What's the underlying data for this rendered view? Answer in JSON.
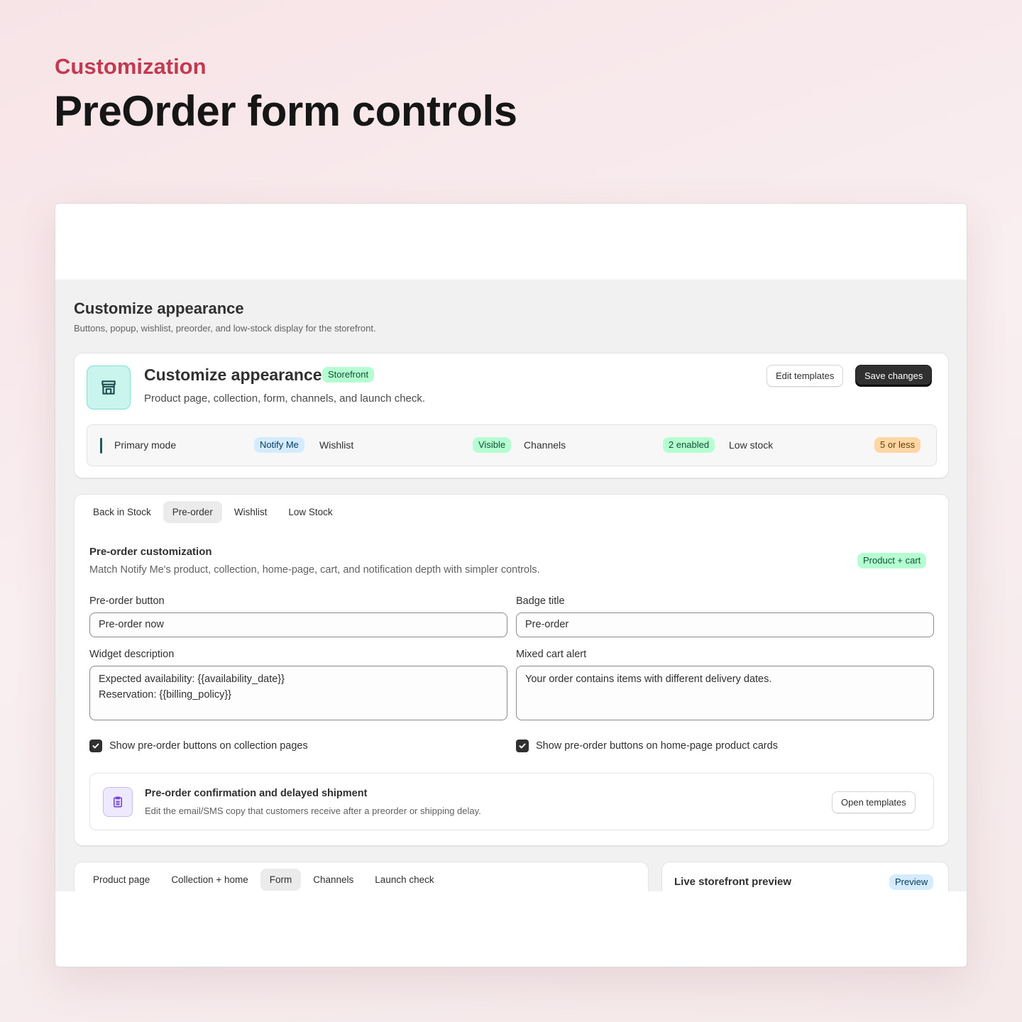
{
  "hero": {
    "eyebrow": "Customization",
    "title": "PreOrder form controls"
  },
  "page": {
    "heading": "Customize appearance",
    "subheading": "Buttons, popup, wishlist, preorder, and low-stock display for the storefront."
  },
  "summary_card": {
    "icon": "storefront-icon",
    "title": "Customize appearance",
    "badge": "Storefront",
    "description": "Product page, collection, form, channels, and launch check.",
    "edit_label": "Edit templates",
    "save_label": "Save changes",
    "stats": [
      {
        "label": "Primary mode",
        "value": "Notify Me",
        "tone": "blue"
      },
      {
        "label": "Wishlist",
        "value": "Visible",
        "tone": "green"
      },
      {
        "label": "Channels",
        "value": "2 enabled",
        "tone": "green"
      },
      {
        "label": "Low stock",
        "value": "5 or less",
        "tone": "orange"
      }
    ]
  },
  "feature_tabs": {
    "items": [
      "Back in Stock",
      "Pre-order",
      "Wishlist",
      "Low Stock"
    ],
    "active": "Pre-order"
  },
  "preorder": {
    "title": "Pre-order customization",
    "description": "Match Notify Me's product, collection, home-page, cart, and notification depth with simpler controls.",
    "scope_badge": "Product + cart",
    "button_label": "Pre-order button",
    "button_value": "Pre-order now",
    "badge_label": "Badge title",
    "badge_value": "Pre-order",
    "widget_label": "Widget description",
    "widget_line1": "Expected availability: {{availability_date}}",
    "widget_line2": "Reservation: {{billing_policy}}",
    "cart_alert_label": "Mixed cart alert",
    "cart_alert_value": "Your order contains items with different delivery dates.",
    "check_collection": "Show pre-order buttons on collection pages",
    "check_home": "Show pre-order buttons on home-page product cards",
    "check_collection_checked": true,
    "check_home_checked": true
  },
  "notification_card": {
    "icon": "clipboard-icon",
    "title": "Pre-order confirmation and delayed shipment",
    "description": "Edit the email/SMS copy that customers receive after a preorder or shipping delay.",
    "button_label": "Open templates"
  },
  "section_tabs": {
    "items": [
      "Product page",
      "Collection + home",
      "Form",
      "Channels",
      "Launch check"
    ],
    "active": "Form"
  },
  "preview": {
    "title": "Live storefront preview",
    "badge": "Preview"
  },
  "colors": {
    "accent": "#c23a4f",
    "primary_button": "#303030",
    "badge_green": "#b4fed2",
    "badge_blue": "#d5ebff",
    "badge_orange": "#ffd6a4"
  }
}
